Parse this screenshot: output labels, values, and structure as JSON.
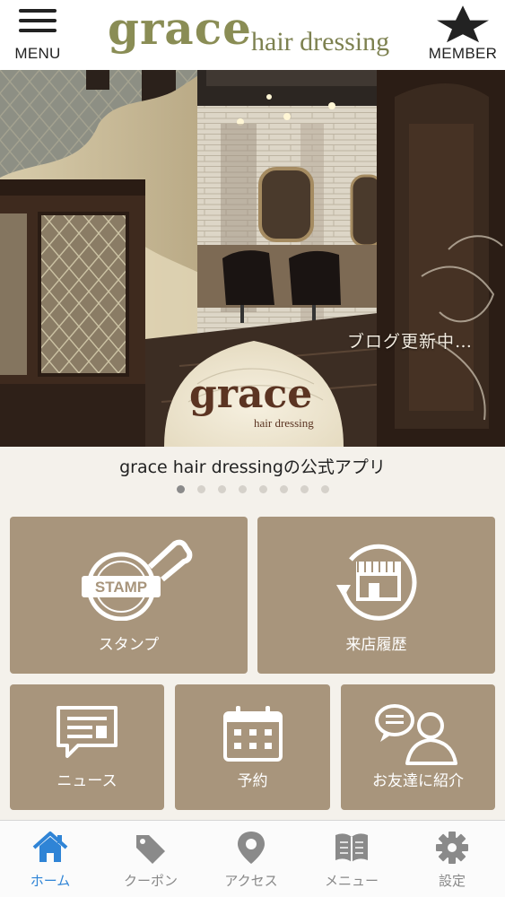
{
  "header": {
    "menu_label": "MENU",
    "member_label": "MEMBER",
    "logo_word": "grace",
    "logo_sub": "hair dressing"
  },
  "hero": {
    "caption": "ブログ更新中…",
    "badge_word": "grace",
    "badge_sub": "hair dressing"
  },
  "tagline": "grace hair dressingの公式アプリ",
  "carousel": {
    "total": 8,
    "active_index": 0
  },
  "tiles": [
    {
      "label": "スタンプ",
      "icon": "stamp-icon",
      "badge_text": "STAMP"
    },
    {
      "label": "来店履歴",
      "icon": "shop-history-icon"
    },
    {
      "label": "ニュース",
      "icon": "news-icon"
    },
    {
      "label": "予約",
      "icon": "calendar-icon"
    },
    {
      "label": "お友達に紹介",
      "icon": "friend-refer-icon"
    }
  ],
  "bottom_nav": [
    {
      "label": "ホーム",
      "icon": "home-icon",
      "active": true
    },
    {
      "label": "クーポン",
      "icon": "coupon-tag-icon",
      "active": false
    },
    {
      "label": "アクセス",
      "icon": "map-pin-icon",
      "active": false
    },
    {
      "label": "メニュー",
      "icon": "book-icon",
      "active": false
    },
    {
      "label": "設定",
      "icon": "gear-icon",
      "active": false
    }
  ],
  "colors": {
    "tile": "#a8957c",
    "logo": "#8a8d55",
    "nav_active": "#2f84d6",
    "nav_inactive": "#888888"
  }
}
